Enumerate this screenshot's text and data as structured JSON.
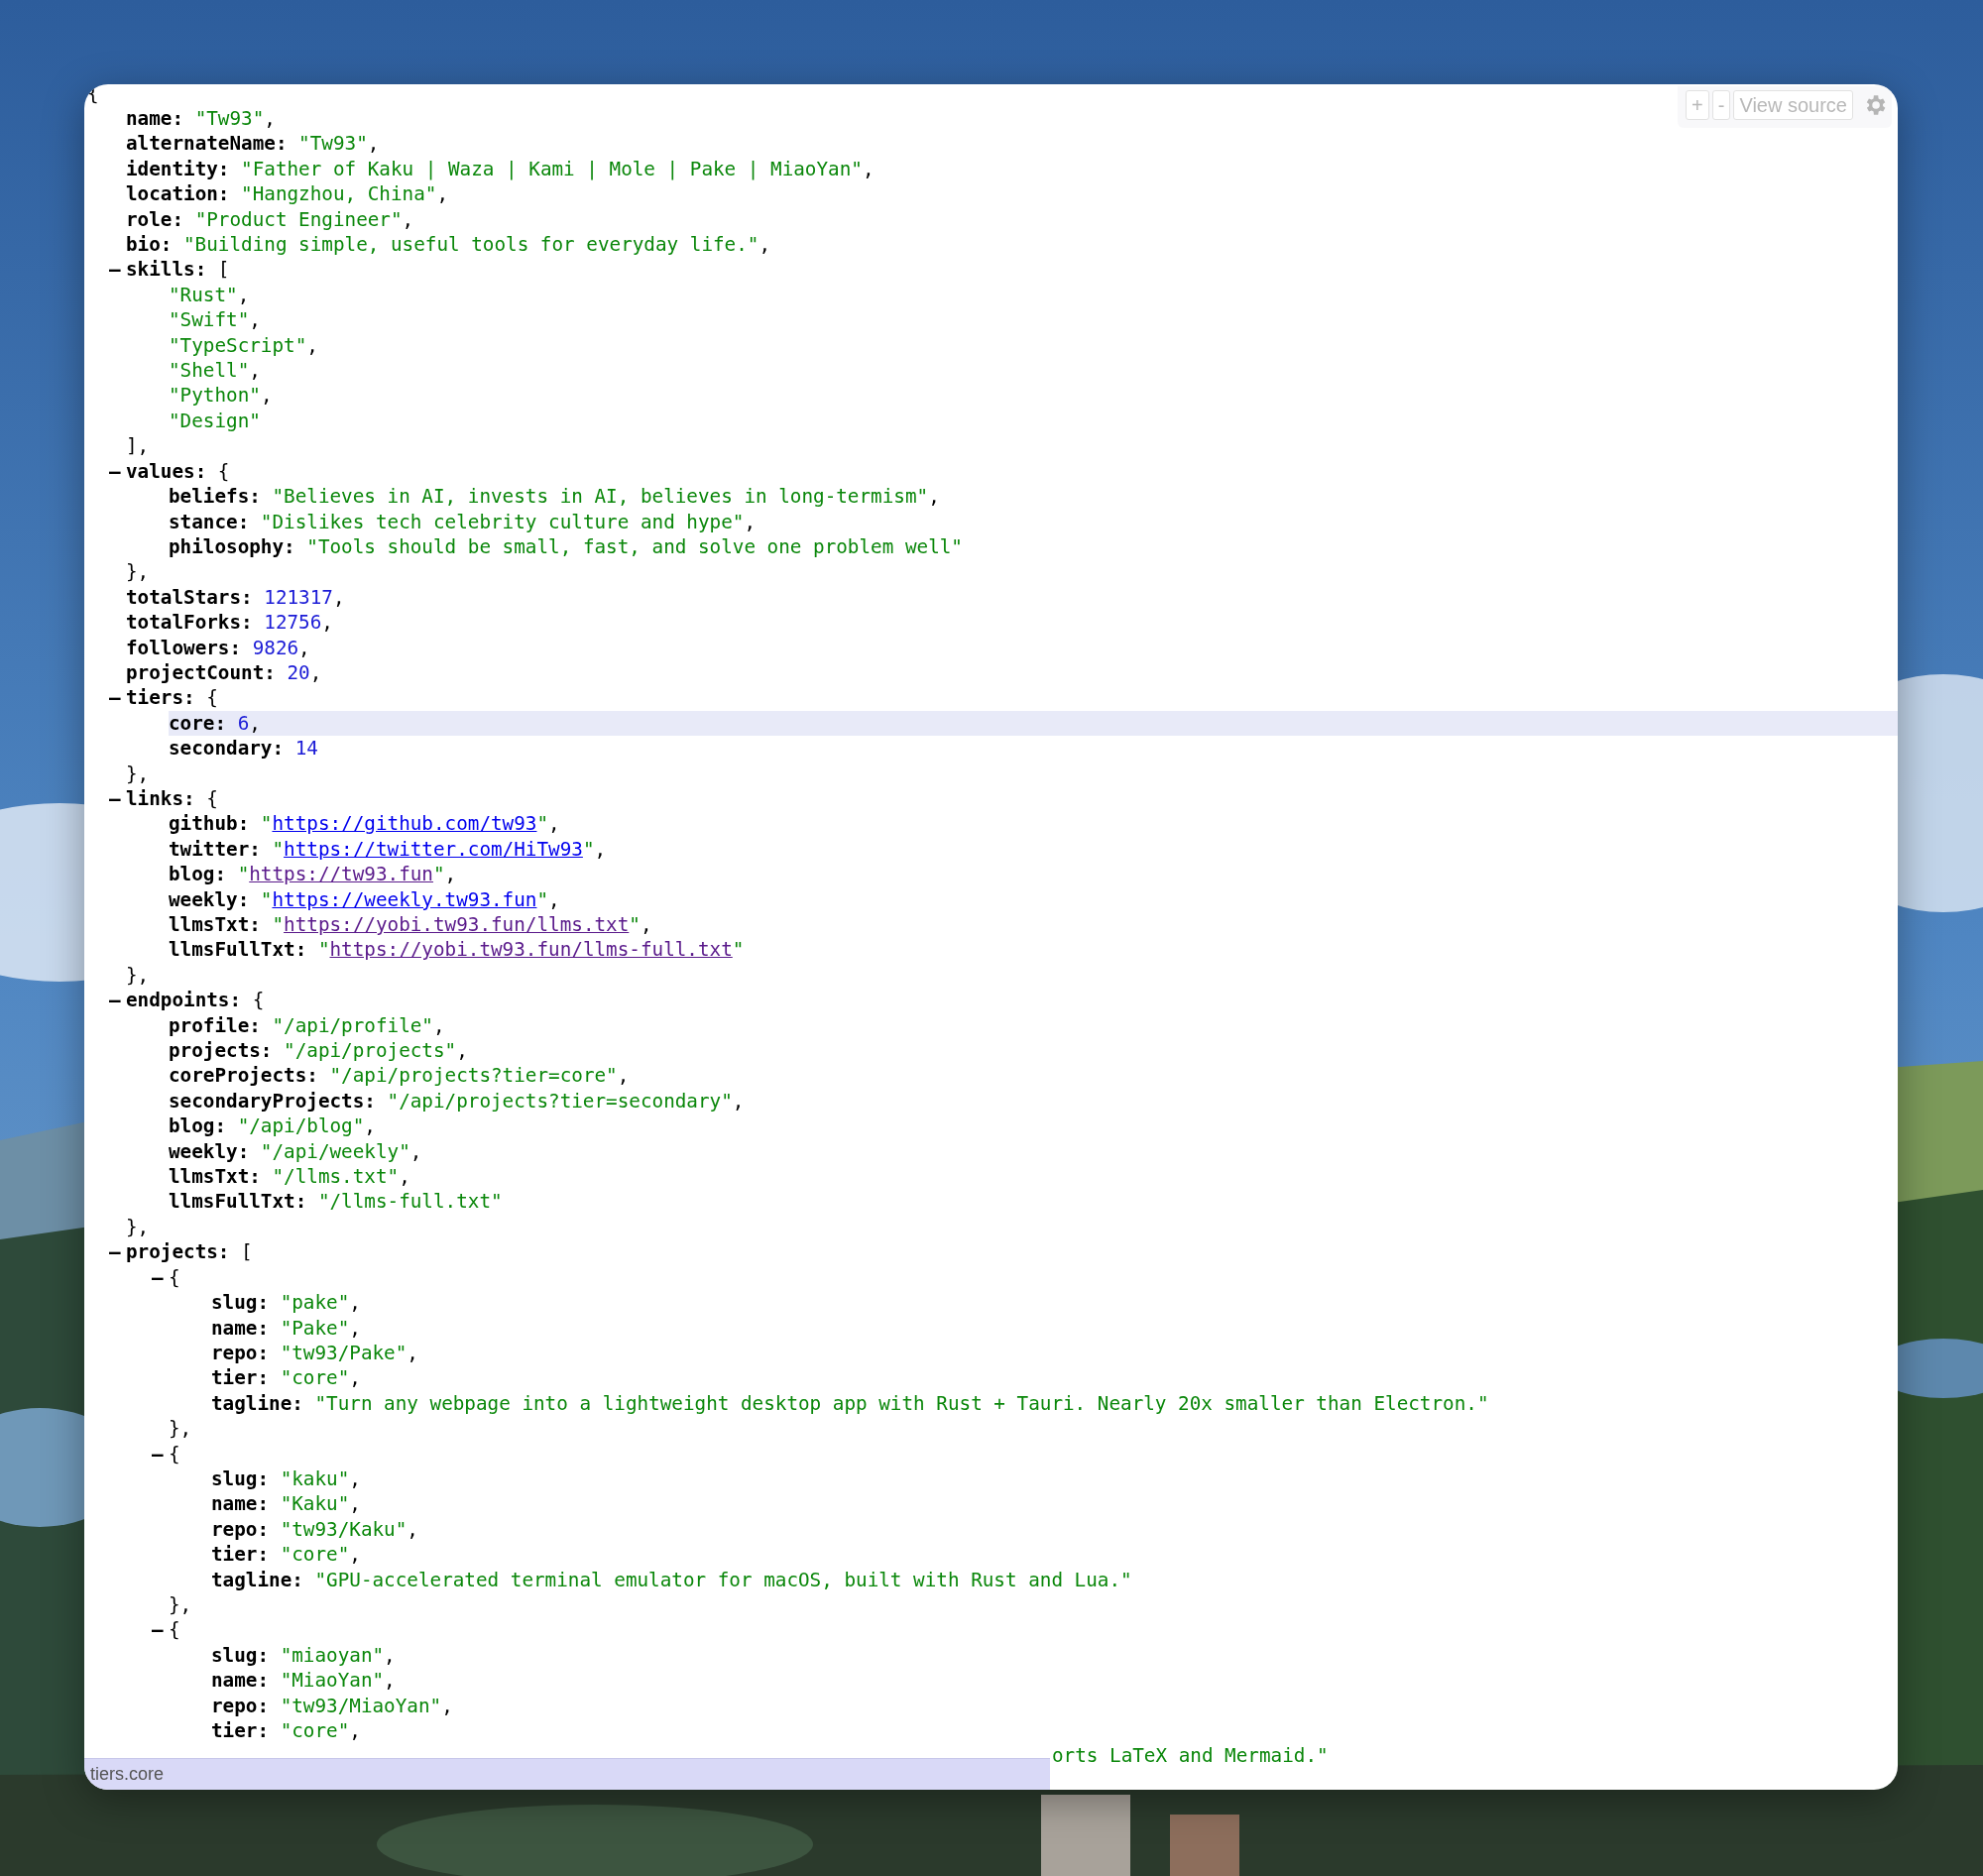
{
  "viewer": {
    "open": "{",
    "members": [
      {
        "key": "name:",
        "kind": "string",
        "value": "\"Tw93\"",
        "end": ",",
        "selected": false
      },
      {
        "key": "alternateName:",
        "kind": "string",
        "value": "\"Tw93\"",
        "end": ",",
        "selected": false
      },
      {
        "key": "identity:",
        "kind": "string",
        "value": "\"Father of Kaku | Waza | Kami | Mole | Pake | MiaoYan\"",
        "end": ",",
        "selected": false
      },
      {
        "key": "location:",
        "kind": "string",
        "value": "\"Hangzhou, China\"",
        "end": ",",
        "selected": false
      },
      {
        "key": "role:",
        "kind": "string",
        "value": "\"Product Engineer\"",
        "end": ",",
        "selected": false
      },
      {
        "key": "bio:",
        "kind": "string",
        "value": "\"Building simple, useful tools for everyday life.\"",
        "end": ",",
        "selected": false
      },
      {
        "key": "skills:",
        "kind": "container",
        "toggle": "–",
        "open": "[",
        "close": "],",
        "children": [
          {
            "kind": "string",
            "value": "\"Rust\"",
            "end": ",",
            "selected": false
          },
          {
            "kind": "string",
            "value": "\"Swift\"",
            "end": ",",
            "selected": false
          },
          {
            "kind": "string",
            "value": "\"TypeScript\"",
            "end": ",",
            "selected": false
          },
          {
            "kind": "string",
            "value": "\"Shell\"",
            "end": ",",
            "selected": false
          },
          {
            "kind": "string",
            "value": "\"Python\"",
            "end": ",",
            "selected": false
          },
          {
            "kind": "string",
            "value": "\"Design\"",
            "selected": false
          }
        ]
      },
      {
        "key": "values:",
        "kind": "container",
        "toggle": "–",
        "open": "{",
        "close": "},",
        "children": [
          {
            "key": "beliefs:",
            "kind": "string",
            "value": "\"Believes in AI, invests in AI, believes in long-termism\"",
            "end": ",",
            "selected": false
          },
          {
            "key": "stance:",
            "kind": "string",
            "value": "\"Dislikes tech celebrity culture and hype\"",
            "end": ",",
            "selected": false
          },
          {
            "key": "philosophy:",
            "kind": "string",
            "value": "\"Tools should be small, fast, and solve one problem well\"",
            "selected": false
          }
        ]
      },
      {
        "key": "totalStars:",
        "kind": "number",
        "value": "121317",
        "end": ",",
        "selected": false
      },
      {
        "key": "totalForks:",
        "kind": "number",
        "value": "12756",
        "end": ",",
        "selected": false
      },
      {
        "key": "followers:",
        "kind": "number",
        "value": "9826",
        "end": ",",
        "selected": false
      },
      {
        "key": "projectCount:",
        "kind": "number",
        "value": "20",
        "end": ",",
        "selected": false
      },
      {
        "key": "tiers:",
        "kind": "container",
        "toggle": "–",
        "open": "{",
        "close": "},",
        "children": [
          {
            "key": "core:",
            "kind": "number",
            "value": "6",
            "end": ",",
            "selected": true
          },
          {
            "key": "secondary:",
            "kind": "number",
            "value": "14",
            "selected": false
          }
        ]
      },
      {
        "key": "links:",
        "kind": "container",
        "toggle": "–",
        "open": "{",
        "close": "},",
        "children": [
          {
            "key": "github:",
            "kind": "link",
            "quote_open": "\"",
            "value": "https://github.com/tw93",
            "quote_close": "\"",
            "end": ",",
            "visited": false,
            "selected": false
          },
          {
            "key": "twitter:",
            "kind": "link",
            "quote_open": "\"",
            "value": "https://twitter.com/HiTw93",
            "quote_close": "\"",
            "end": ",",
            "visited": false,
            "selected": false
          },
          {
            "key": "blog:",
            "kind": "link",
            "quote_open": "\"",
            "value": "https://tw93.fun",
            "quote_close": "\"",
            "end": ",",
            "visited": true,
            "selected": false
          },
          {
            "key": "weekly:",
            "kind": "link",
            "quote_open": "\"",
            "value": "https://weekly.tw93.fun",
            "quote_close": "\"",
            "end": ",",
            "visited": false,
            "selected": false
          },
          {
            "key": "llmsTxt:",
            "kind": "link",
            "quote_open": "\"",
            "value": "https://yobi.tw93.fun/llms.txt",
            "quote_close": "\"",
            "end": ",",
            "visited": true,
            "selected": false
          },
          {
            "key": "llmsFullTxt:",
            "kind": "link",
            "quote_open": "\"",
            "value": "https://yobi.tw93.fun/llms-full.txt",
            "quote_close": "\"",
            "visited": true,
            "selected": false
          }
        ]
      },
      {
        "key": "endpoints:",
        "kind": "container",
        "toggle": "–",
        "open": "{",
        "close": "},",
        "children": [
          {
            "key": "profile:",
            "kind": "string",
            "value": "\"/api/profile\"",
            "end": ",",
            "selected": false
          },
          {
            "key": "projects:",
            "kind": "string",
            "value": "\"/api/projects\"",
            "end": ",",
            "selected": false
          },
          {
            "key": "coreProjects:",
            "kind": "string",
            "value": "\"/api/projects?tier=core\"",
            "end": ",",
            "selected": false
          },
          {
            "key": "secondaryProjects:",
            "kind": "string",
            "value": "\"/api/projects?tier=secondary\"",
            "end": ",",
            "selected": false
          },
          {
            "key": "blog:",
            "kind": "string",
            "value": "\"/api/blog\"",
            "end": ",",
            "selected": false
          },
          {
            "key": "weekly:",
            "kind": "string",
            "value": "\"/api/weekly\"",
            "end": ",",
            "selected": false
          },
          {
            "key": "llmsTxt:",
            "kind": "string",
            "value": "\"/llms.txt\"",
            "end": ",",
            "selected": false
          },
          {
            "key": "llmsFullTxt:",
            "kind": "string",
            "value": "\"/llms-full.txt\"",
            "selected": false
          }
        ]
      },
      {
        "key": "projects:",
        "kind": "container",
        "toggle": "–",
        "open": "[",
        "children": [
          {
            "kind": "container",
            "toggle": "–",
            "open": "{",
            "close": "},",
            "children": [
              {
                "key": "slug:",
                "kind": "string",
                "value": "\"pake\"",
                "end": ",",
                "selected": false
              },
              {
                "key": "name:",
                "kind": "string",
                "value": "\"Pake\"",
                "end": ",",
                "selected": false
              },
              {
                "key": "repo:",
                "kind": "string",
                "value": "\"tw93/Pake\"",
                "end": ",",
                "selected": false
              },
              {
                "key": "tier:",
                "kind": "string",
                "value": "\"core\"",
                "end": ",",
                "selected": false
              },
              {
                "key": "tagline:",
                "kind": "string",
                "value": "\"Turn any webpage into a lightweight desktop app with Rust + Tauri. Nearly 20x smaller than Electron.\"",
                "selected": false
              }
            ]
          },
          {
            "kind": "container",
            "toggle": "–",
            "open": "{",
            "close": "},",
            "children": [
              {
                "key": "slug:",
                "kind": "string",
                "value": "\"kaku\"",
                "end": ",",
                "selected": false
              },
              {
                "key": "name:",
                "kind": "string",
                "value": "\"Kaku\"",
                "end": ",",
                "selected": false
              },
              {
                "key": "repo:",
                "kind": "string",
                "value": "\"tw93/Kaku\"",
                "end": ",",
                "selected": false
              },
              {
                "key": "tier:",
                "kind": "string",
                "value": "\"core\"",
                "end": ",",
                "selected": false
              },
              {
                "key": "tagline:",
                "kind": "string",
                "value": "\"GPU-accelerated terminal emulator for macOS, built with Rust and Lua.\"",
                "selected": false
              }
            ]
          },
          {
            "kind": "container",
            "toggle": "–",
            "open": "{",
            "children": [
              {
                "key": "slug:",
                "kind": "string",
                "value": "\"miaoyan\"",
                "end": ",",
                "selected": false
              },
              {
                "key": "name:",
                "kind": "string",
                "value": "\"MiaoYan\"",
                "end": ",",
                "selected": false
              },
              {
                "key": "repo:",
                "kind": "string",
                "value": "\"tw93/MiaoYan\"",
                "end": ",",
                "selected": false
              },
              {
                "key": "tier:",
                "kind": "string",
                "value": "\"core\"",
                "end": ",",
                "selected": false
              },
              {
                "kind": "fragment",
                "value": "orts LaTeX and Mermaid.\"",
                "selected": false
              }
            ]
          }
        ]
      }
    ]
  },
  "toolbar": {
    "zoom_in": "+",
    "zoom_out": "-",
    "view_source": "View source"
  },
  "status_bar": {
    "path": "tiers.core"
  }
}
